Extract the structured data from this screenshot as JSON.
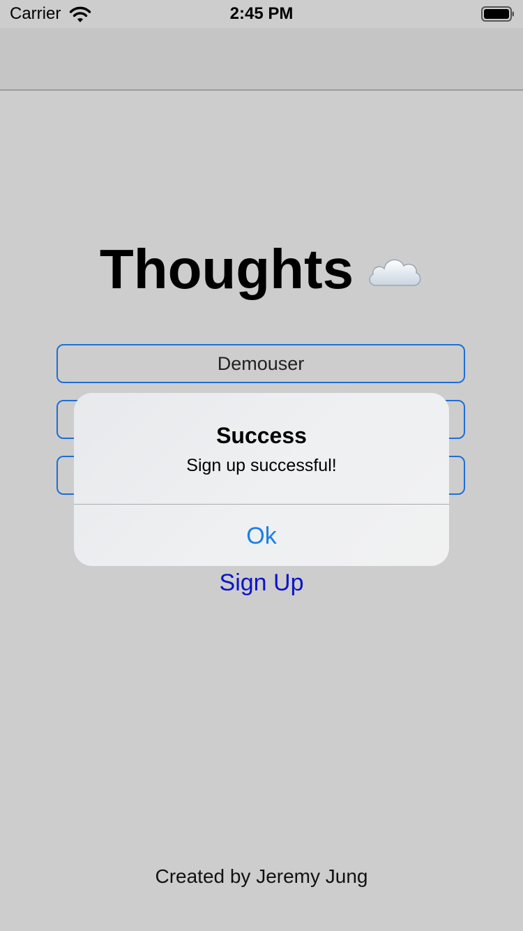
{
  "status_bar": {
    "carrier": "Carrier",
    "time": "2:45 PM"
  },
  "app": {
    "title": "Thoughts",
    "title_icon": "cloud-icon"
  },
  "form": {
    "username_value": "Demouser",
    "signup_label": "Sign Up"
  },
  "footer": {
    "credit": "Created by Jeremy Jung"
  },
  "alert": {
    "title": "Success",
    "message": "Sign up successful!",
    "ok_label": "Ok"
  },
  "colors": {
    "background": "#cdcdcd",
    "field_border": "#1e6fd4",
    "link": "#0a14c9",
    "alert_button": "#1a7ee6"
  }
}
